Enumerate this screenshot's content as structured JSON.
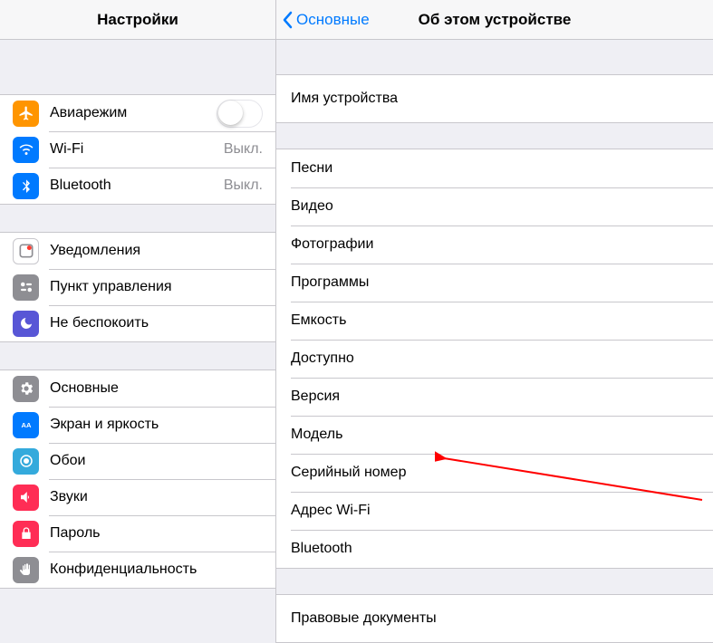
{
  "sidebar": {
    "title": "Настройки",
    "groups": [
      [
        {
          "key": "airplane",
          "label": "Авиарежим",
          "control": "toggle",
          "on": false
        },
        {
          "key": "wifi",
          "label": "Wi-Fi",
          "value": "Выкл."
        },
        {
          "key": "bluetooth",
          "label": "Bluetooth",
          "value": "Выкл."
        }
      ],
      [
        {
          "key": "notifications",
          "label": "Уведомления"
        },
        {
          "key": "controlcenter",
          "label": "Пункт управления"
        },
        {
          "key": "dnd",
          "label": "Не беспокоить"
        }
      ],
      [
        {
          "key": "general",
          "label": "Основные"
        },
        {
          "key": "display",
          "label": "Экран и яркость"
        },
        {
          "key": "wallpaper",
          "label": "Обои"
        },
        {
          "key": "sounds",
          "label": "Звуки"
        },
        {
          "key": "passcode",
          "label": "Пароль"
        },
        {
          "key": "privacy",
          "label": "Конфиденциальность"
        }
      ]
    ]
  },
  "detail": {
    "back_label": "Основные",
    "title": "Об этом устройстве",
    "groups": [
      [
        {
          "key": "devicename",
          "label": "Имя устройства"
        }
      ],
      [
        {
          "key": "songs",
          "label": "Песни"
        },
        {
          "key": "videos",
          "label": "Видео"
        },
        {
          "key": "photos",
          "label": "Фотографии"
        },
        {
          "key": "apps",
          "label": "Программы"
        },
        {
          "key": "capacity",
          "label": "Емкость"
        },
        {
          "key": "avail",
          "label": "Доступно"
        },
        {
          "key": "version",
          "label": "Версия"
        },
        {
          "key": "model",
          "label": "Модель"
        },
        {
          "key": "serial",
          "label": "Серийный номер"
        },
        {
          "key": "wifiaddr",
          "label": "Адрес Wi-Fi"
        },
        {
          "key": "btaddr",
          "label": "Bluetooth"
        }
      ],
      [
        {
          "key": "legal",
          "label": "Правовые документы"
        }
      ]
    ]
  },
  "icon_colors": {
    "airplane": "#ff9500",
    "wifi": "#007aff",
    "bluetooth": "#007aff",
    "notifications": "#8e8e93",
    "controlcenter": "#8e8e93",
    "dnd": "#5856d6",
    "general": "#8e8e93",
    "display": "#007aff",
    "wallpaper": "#34aadc",
    "sounds": "#ff2d55",
    "passcode": "#ff2d55",
    "privacy": "#8e8e93"
  }
}
